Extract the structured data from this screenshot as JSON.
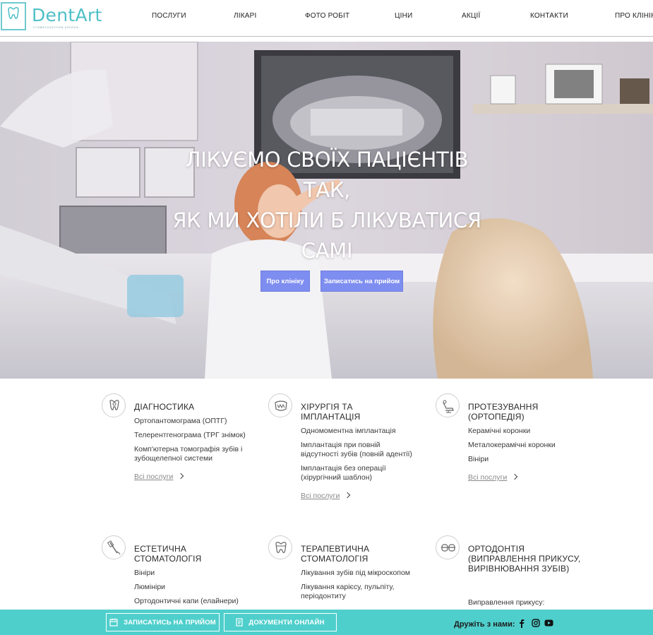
{
  "logo": {
    "name": "DentArt",
    "subtitle": "стоматологічна клініка"
  },
  "nav": [
    {
      "label": "ПОСЛУГИ"
    },
    {
      "label": "ЛІКАРІ"
    },
    {
      "label": "ФОТО РОБІТ"
    },
    {
      "label": "ЦІНИ"
    },
    {
      "label": "АКЦІЇ"
    },
    {
      "label": "КОНТАКТИ"
    },
    {
      "label": "ПРО КЛІНІКУ"
    }
  ],
  "hero": {
    "title": "ЛІКУЄМО СВОЇХ ПАЦІЄНТІВ\nТАК,\nЯК МИ ХОТІЛИ Б ЛІКУВАТИСЯ\nСАМІ",
    "btn_about": "Про клініку",
    "btn_appointment": "Записатись на прийом"
  },
  "services": [
    {
      "title": "ДІАГНОСТИКА",
      "icon": "tooth-xray-icon",
      "items": [
        "Ортопантомограма (ОПТГ)",
        "Телерентгенограма (ТРГ знімок)",
        "Комп'ютерна томографія зубів і зубощелепної системи"
      ],
      "all": "Всі послуги"
    },
    {
      "title": "ХІРУРГІЯ ТА ІМПЛАНТАЦІЯ",
      "icon": "jaw-icon",
      "items": [
        "Одномоментна імплантація",
        "Імплантація при повній відсутності зубів (повній адентії)",
        "Імплантація без операції (хірургічний шаблон)"
      ],
      "all": "Всі послуги"
    },
    {
      "title": "ПРОТЕЗУВАННЯ (ОРТОПЕДІЯ)",
      "icon": "dental-chair-icon",
      "items": [
        "Керамічні коронки",
        "Металокерамічні коронки",
        "Вініри"
      ],
      "all": "Всі послуги"
    },
    {
      "title": "ЕСТЕТИЧНА СТОМАТОЛОГІЯ",
      "icon": "toothbrush-icon",
      "items": [
        "Вініри",
        "Люмініри",
        "Ортодонтичні капи (елайнери)"
      ]
    },
    {
      "title": "ТЕРАПЕВТИЧНА СТОМАТОЛОГІЯ",
      "icon": "tooth-crown-icon",
      "items": [
        "Лікування зубів під мікроскопом",
        "Лікування карієсу, пульпіту, періодонтиту"
      ]
    },
    {
      "title": "ОРТОДОНТІЯ (ВИПРАВЛЕННЯ ПРИКУСУ, ВИРІВНЮВАННЯ ЗУБІВ)",
      "icon": "braces-icon",
      "items": [
        "Виправлення прикусу:"
      ]
    }
  ],
  "bottom": {
    "appointment": "ЗАПИСАТИСЬ НА ПРИЙОМ",
    "documents": "ДОКУМЕНТИ ОНЛАЙН",
    "follow": "Дружіть з нами:"
  },
  "colors": {
    "accent": "#4fcfcc",
    "hero_button": "#7e8df0",
    "logo": "#4fbfc6"
  }
}
